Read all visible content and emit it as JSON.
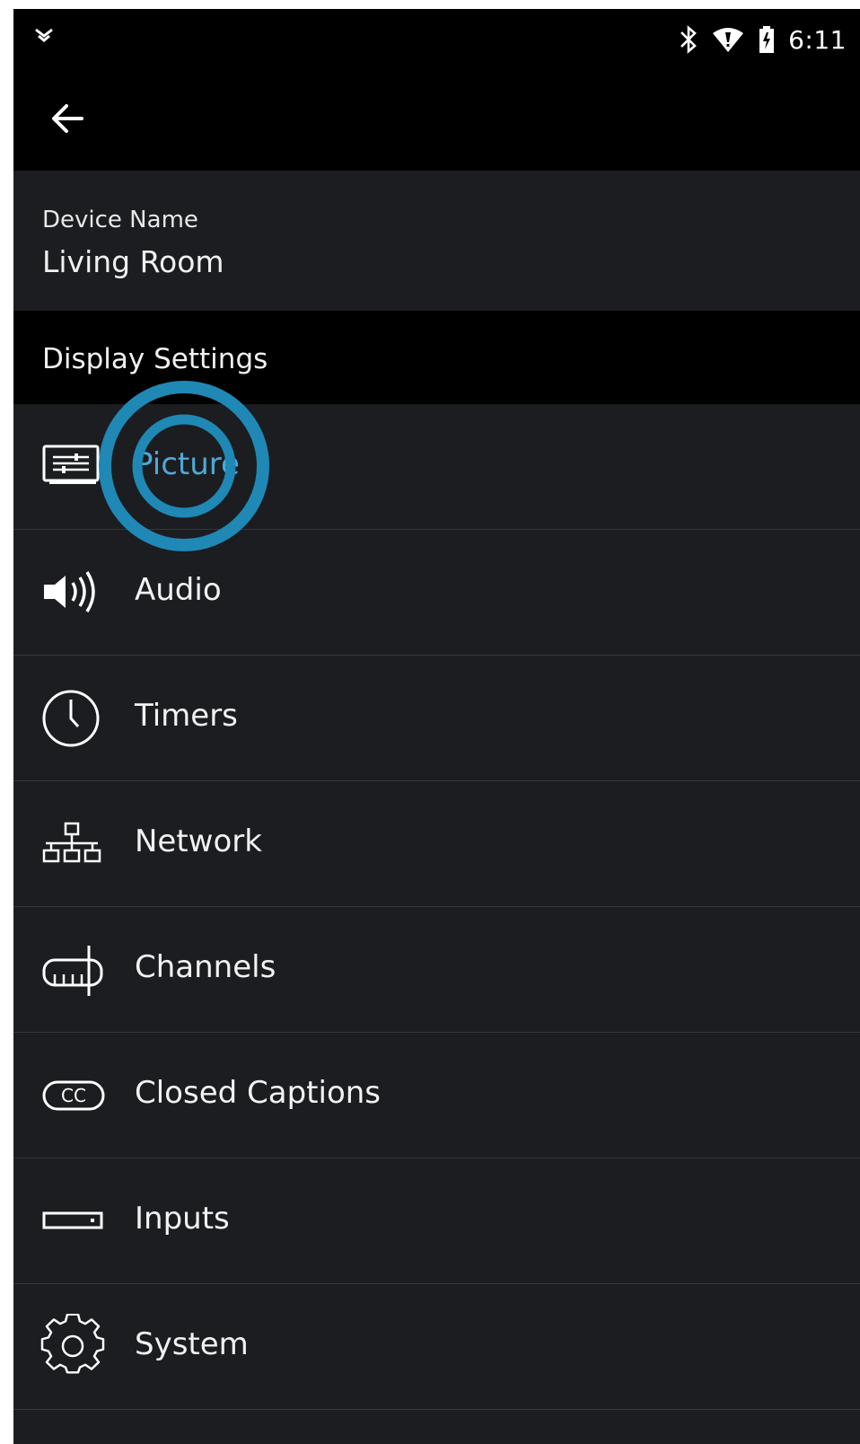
{
  "status_bar": {
    "time": "6:11",
    "icons": [
      "notification-chevron-icon",
      "bluetooth-icon",
      "wifi-icon",
      "battery-icon"
    ]
  },
  "app_bar": {
    "back_icon": "arrow-left-icon"
  },
  "device": {
    "label": "Device Name",
    "value": "Living Room"
  },
  "section": {
    "title": "Display Settings"
  },
  "menu": {
    "items": [
      {
        "label": "Picture",
        "icon": "picture-icon"
      },
      {
        "label": "Audio",
        "icon": "speaker-icon"
      },
      {
        "label": "Timers",
        "icon": "clock-icon"
      },
      {
        "label": "Network",
        "icon": "network-icon"
      },
      {
        "label": "Channels",
        "icon": "antenna-icon"
      },
      {
        "label": "Closed Captions",
        "icon": "closed-captions-icon"
      },
      {
        "label": "Inputs",
        "icon": "input-port-icon"
      },
      {
        "label": "System",
        "icon": "gear-icon"
      }
    ]
  },
  "colors": {
    "accent": "#1f88b5",
    "background": "#1b1d20",
    "header": "#000000",
    "text": "#f2f2f2"
  }
}
